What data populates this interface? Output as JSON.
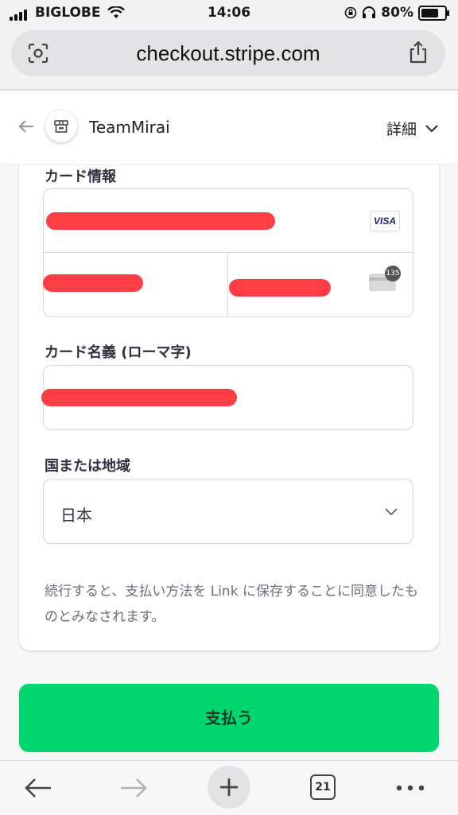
{
  "status_bar": {
    "carrier": "BIGLOBE",
    "time": "14:06",
    "battery": "80%"
  },
  "browser": {
    "url": "checkout.stripe.com",
    "tab_count": "21"
  },
  "header": {
    "merchant_name": "TeamMirai",
    "details_label": "詳細"
  },
  "form": {
    "card_info_label": "カード情報",
    "card_brand": "VISA",
    "cvc_hint": "135",
    "cardholder_label": "カード名義 (ローマ字)",
    "country_label": "国または地域",
    "country_value": "日本",
    "consent_text": "続行すると、支払い方法を Link に保存することに同意したものとみなされます。"
  },
  "pay_button_label": "支払う",
  "colors": {
    "pay_button": "#00d66f",
    "redaction": "#ff3d45"
  }
}
